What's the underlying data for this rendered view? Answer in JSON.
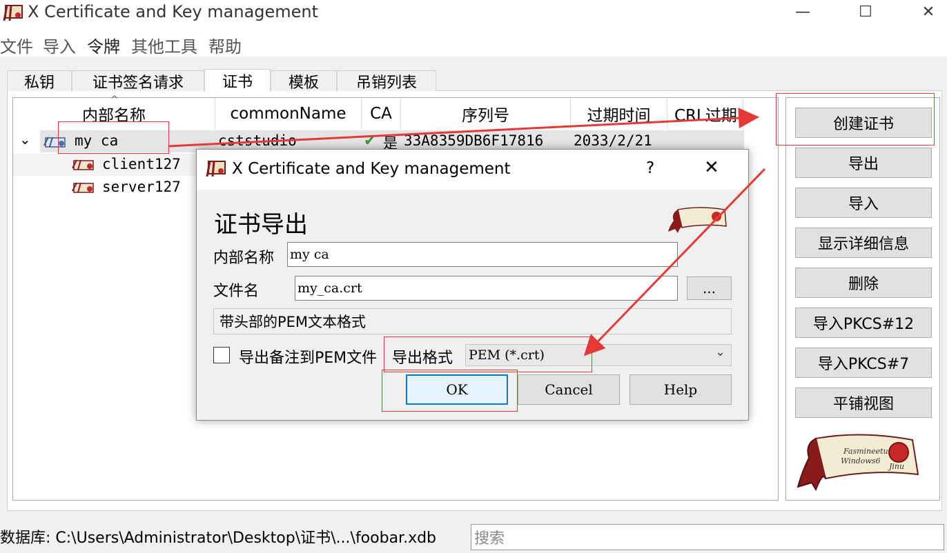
{
  "window": {
    "title": "X Certificate and Key management"
  },
  "menu": [
    "文件",
    "导入",
    "令牌",
    "其他工具",
    "帮助"
  ],
  "tabs": [
    "私钥",
    "证书签名请求",
    "证书",
    "模板",
    "吊销列表"
  ],
  "columns": [
    "内部名称",
    "commonName",
    "CA",
    "序列号",
    "过期时间",
    "CRL过期"
  ],
  "tree": {
    "root": {
      "name": "my ca",
      "common_name": "cststudio",
      "ca": "是",
      "serial": "33A8359DB6F17816",
      "expiry": "2033/2/21"
    },
    "children": [
      "client127",
      "server127"
    ]
  },
  "buttons": [
    "创建证书",
    "导出",
    "导入",
    "显示详细信息",
    "删除",
    "导入PKCS#12",
    "导入PKCS#7",
    "平铺视图"
  ],
  "logo_text": [
    "Fasmineetu",
    "Windows6",
    "Jinu"
  ],
  "status": {
    "database": "数据库: C:\\Users\\Administrator\\Desktop\\证书\\...\\foobar.xdb",
    "search_placeholder": "搜索"
  },
  "dialog": {
    "title": "X Certificate and Key management",
    "help": "?",
    "heading": "证书导出",
    "internal_name_label": "内部名称",
    "internal_name": "my ca",
    "filename_label": "文件名",
    "filename": "my_ca.crt",
    "browse": "...",
    "description": "带头部的PEM文本格式",
    "comment_label": "导出备注到PEM文件",
    "format_label": "导出格式",
    "format": "PEM (*.crt)",
    "ok": "OK",
    "cancel": "Cancel",
    "help_btn": "Help"
  },
  "colors": {
    "annotation": "#e53935",
    "accent": "#0078d7"
  }
}
